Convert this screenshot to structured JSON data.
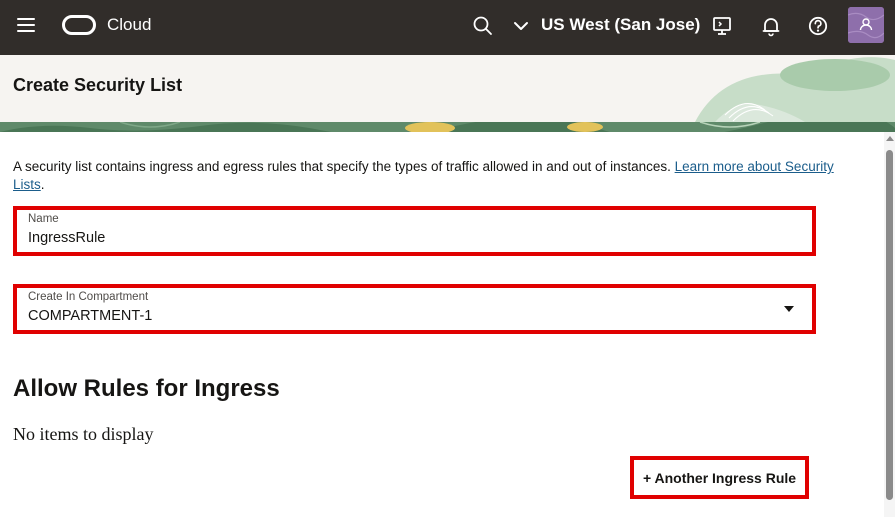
{
  "topbar": {
    "brand": "Cloud",
    "region": "US West (San Jose)"
  },
  "header": {
    "title": "Create Security List"
  },
  "form": {
    "intro_text": "A security list contains ingress and egress rules that specify the types of traffic allowed in and out of instances. ",
    "intro_link": "Learn more about Security Lists",
    "intro_end": ".",
    "name_label": "Name",
    "name_value": "IngressRule",
    "compartment_label": "Create In Compartment",
    "compartment_value": "COMPARTMENT-1"
  },
  "ingress": {
    "section_title": "Allow Rules for Ingress",
    "empty_message": "No items to display",
    "add_button": "+ Another Ingress Rule"
  },
  "colors": {
    "topbar": "#312d2a",
    "header_bg": "#f6f4f1",
    "highlight": "#e00000",
    "link": "#1b5d8b"
  }
}
